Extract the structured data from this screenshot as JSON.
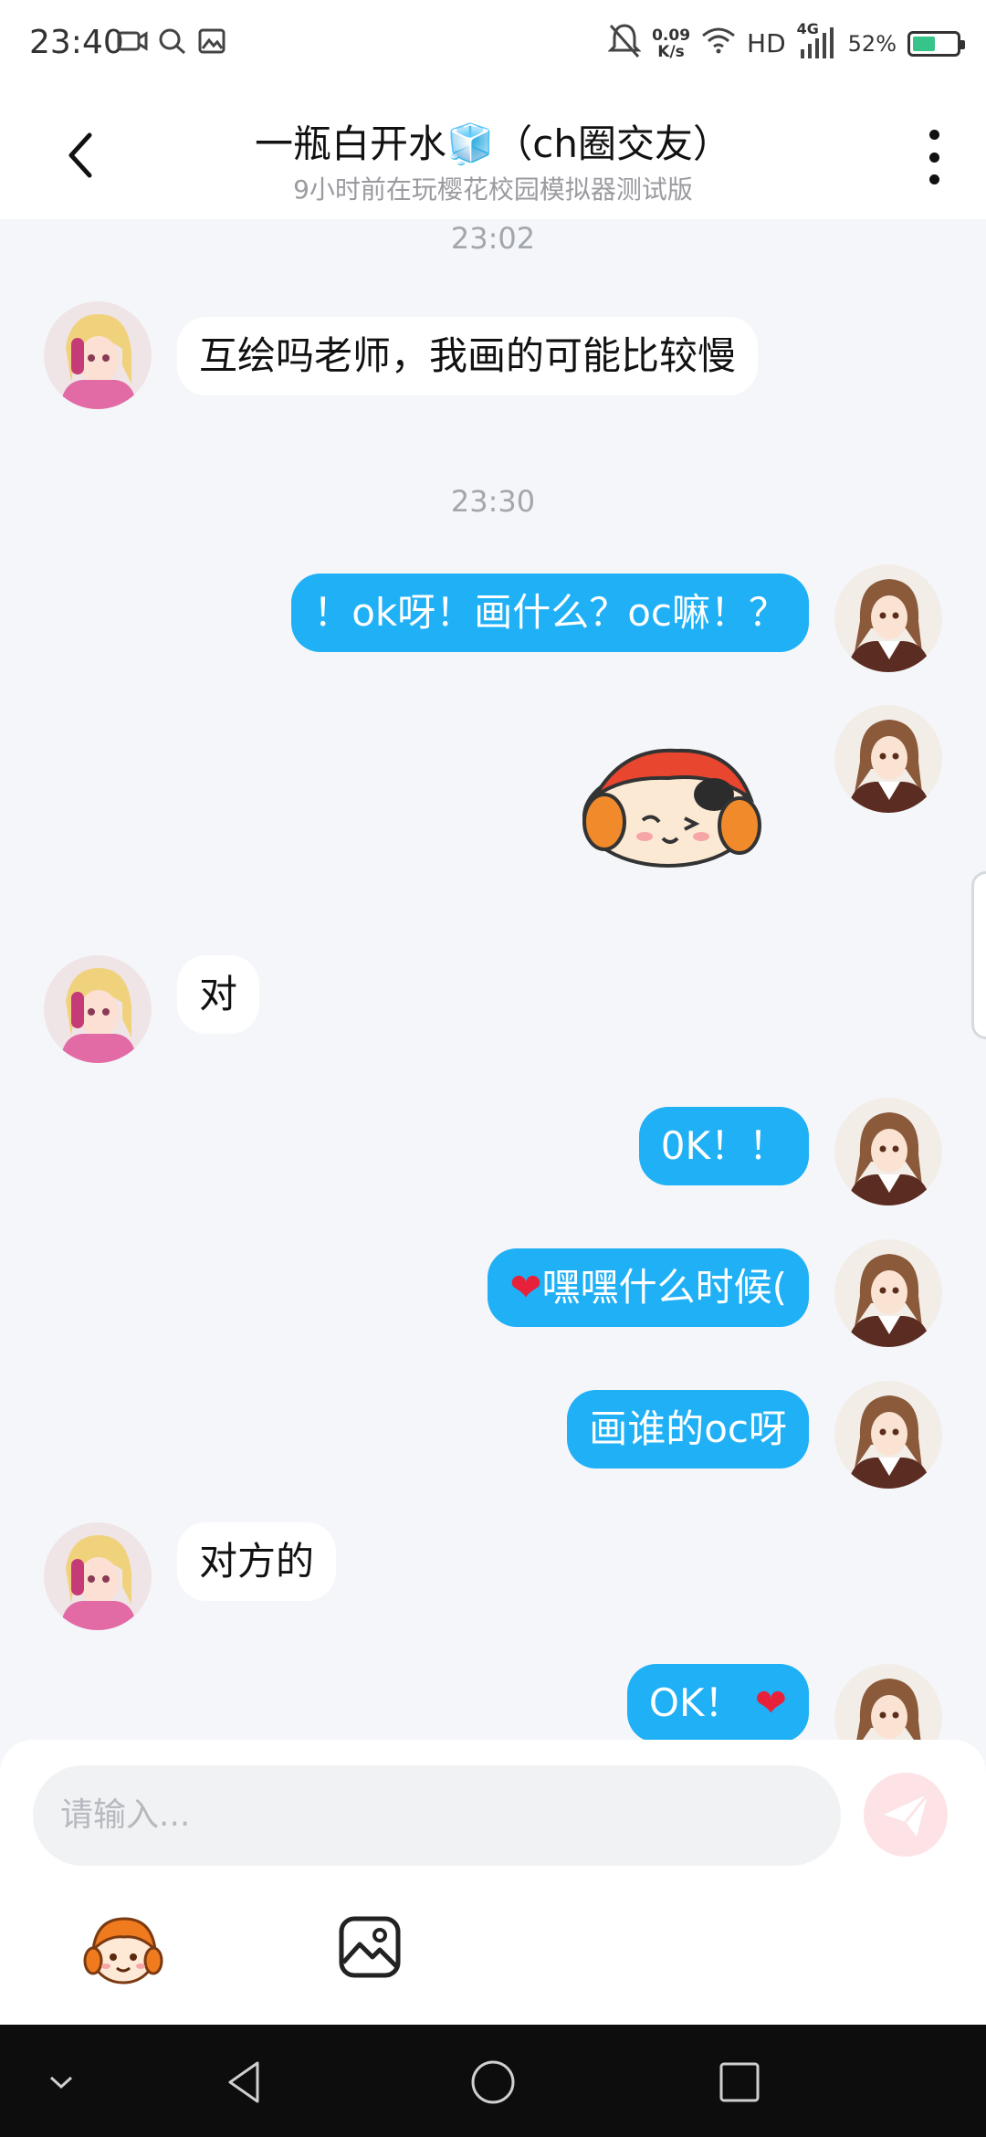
{
  "status_bar": {
    "time": "23:40",
    "net_speed_value": "0.09",
    "net_speed_unit": "K/s",
    "network_label": "HD",
    "cell_label": "4G",
    "battery_percent": "52%",
    "battery_level": 0.52
  },
  "header": {
    "title": "一瓶白开水🧊（ch圈交友）",
    "subtitle": "9小时前在玩樱花校园模拟器测试版"
  },
  "messages": {
    "timestamps": [
      "23:02",
      "23:30"
    ],
    "items": [
      {
        "side": "left",
        "text": "互绘吗老师，我画的可能比较慢"
      },
      {
        "side": "right",
        "text": "！ok呀！画什么？oc嘛！？"
      },
      {
        "side": "right",
        "type": "sticker"
      },
      {
        "side": "left",
        "text": "对"
      },
      {
        "side": "right",
        "text": "0K！！"
      },
      {
        "side": "right",
        "prefix": "❤",
        "text": "嘿嘿什么时候("
      },
      {
        "side": "right",
        "text": "画谁的oc呀"
      },
      {
        "side": "left",
        "text": "对方的"
      },
      {
        "side": "right",
        "text": "OK！",
        "suffix": "❤"
      }
    ]
  },
  "input": {
    "placeholder": "请输入..."
  },
  "colors": {
    "bubble_right": "#1fb0f6",
    "bubble_left": "#ffffff",
    "background": "#f4f6f9",
    "send_button": "#fde3e6"
  },
  "icons": {
    "back": "chevron-left-icon",
    "more": "more-vertical-icon",
    "send": "paper-plane-icon",
    "sticker": "sticker-icon",
    "image": "image-icon",
    "nav_down": "chevron-down-icon",
    "nav_back": "triangle-back-icon",
    "nav_home": "circle-home-icon",
    "nav_recent": "square-recent-icon"
  }
}
